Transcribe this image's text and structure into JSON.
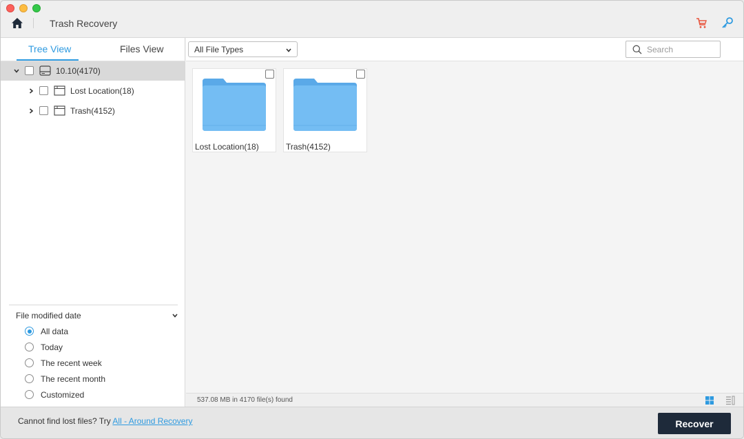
{
  "window": {
    "title": "Trash Recovery"
  },
  "toolbar_icons": {
    "home": "home-icon",
    "cart": "cart-icon",
    "key": "key-icon"
  },
  "sidebar": {
    "tabs": [
      {
        "label": "Tree View",
        "active": true
      },
      {
        "label": "Files View",
        "active": false
      }
    ],
    "tree": [
      {
        "label": "10.10(4170)",
        "level": 0,
        "expanded": true,
        "selected": true,
        "icon": "drive-icon"
      },
      {
        "label": "Lost Location(18)",
        "level": 1,
        "expanded": false,
        "icon": "folder-outline-icon"
      },
      {
        "label": "Trash(4152)",
        "level": 1,
        "expanded": false,
        "icon": "folder-outline-icon"
      }
    ],
    "filter": {
      "title": "File modified date",
      "options": [
        {
          "label": "All data",
          "checked": true
        },
        {
          "label": "Today",
          "checked": false
        },
        {
          "label": "The recent week",
          "checked": false
        },
        {
          "label": "The recent month",
          "checked": false
        },
        {
          "label": "Customized",
          "checked": false
        }
      ]
    }
  },
  "main": {
    "file_type_select": "All File Types",
    "search": {
      "placeholder": "Search",
      "value": ""
    },
    "folders": [
      {
        "label": "Lost Location(18)"
      },
      {
        "label": "Trash(4152)"
      }
    ],
    "status": "537.08 MB in 4170 file(s) found"
  },
  "footer": {
    "hint": "Cannot find lost files? Try ",
    "link": "All - Around Recovery",
    "recover_label": "Recover"
  },
  "colors": {
    "accent": "#2e9ae0",
    "folder": "#6ab4ee",
    "recover_button": "#1e2a3a",
    "cart": "#e8553d"
  }
}
